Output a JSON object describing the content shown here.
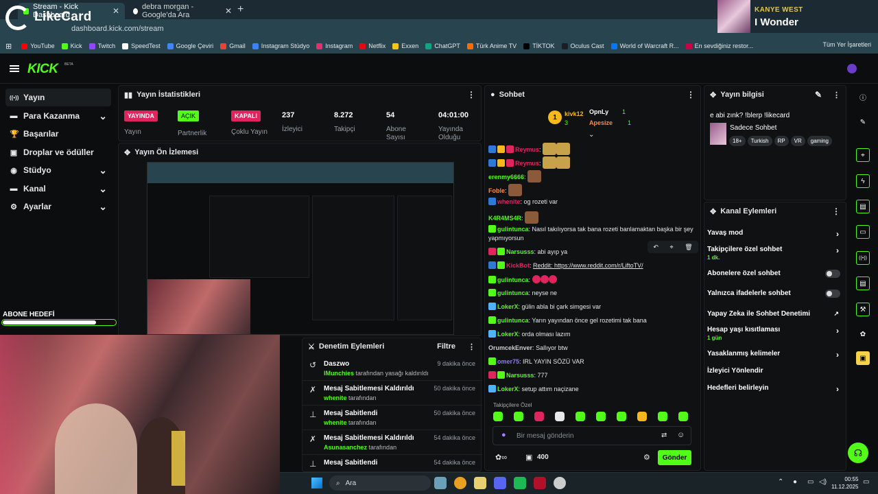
{
  "browser": {
    "tabs": [
      {
        "label": "Stream - Kick Dashboard"
      },
      {
        "label": "debra morgan - Google'da Ara"
      }
    ],
    "url": "dashboard.kick.com/stream",
    "bookmarks": [
      "YouTube",
      "Kick",
      "Twitch",
      "SpeedTest",
      "Google Çeviri",
      "Gmail",
      "Instagram Stüdyo",
      "Instagram",
      "Netflix",
      "Exxen",
      "ChatGPT",
      "Türk Anime TV",
      "TİKTOK",
      "Oculus Cast",
      "World of Warcraft R...",
      "En sevdiğiniz restor..."
    ],
    "all_bookmarks": "Tüm Yer İşaretleri"
  },
  "overlay": {
    "brand": "LikeCard",
    "music_artist": "KANYE WEST",
    "music_title": "I Wonder",
    "abone_hedefi": "ABONE HEDEFİ",
    "abone_progress": 0.83
  },
  "kick": {
    "logo": "KICK",
    "beta": "BETA"
  },
  "sidebar": {
    "items": [
      {
        "label": "Yayın",
        "icon": "broadcast-icon"
      },
      {
        "label": "Para Kazanma",
        "icon": "money-icon"
      },
      {
        "label": "Başarılar",
        "icon": "trophy-icon"
      },
      {
        "label": "Droplar ve ödüller",
        "icon": "gift-icon"
      },
      {
        "label": "Stüdyo",
        "icon": "studio-icon"
      },
      {
        "label": "Kanal",
        "icon": "channel-icon"
      },
      {
        "label": "Ayarlar",
        "icon": "gear-icon"
      }
    ]
  },
  "stats": {
    "title": "Yayın İstatistikleri",
    "yayinda": "YAYINDA",
    "yayin_label": "Yayın",
    "acik": "AÇIK",
    "partnerlik": "Partnerlik Geliri",
    "kapali": "KAPALI",
    "coklu": "Çoklu Yayın",
    "izleyici_val": "237",
    "izleyici": "İzleyici",
    "takipci_val": "8.272",
    "takipci": "Takipçi",
    "abone_val": "54",
    "abone": "Abone Sayısı",
    "sure_val": "04:01:00",
    "sure": "Yayında Olduğu"
  },
  "preview": {
    "title": "Yayın Ön İzlemesi"
  },
  "denetim": {
    "title": "Denetim Eylemleri",
    "filter": "Filtre",
    "items": [
      {
        "title": "Daszwo",
        "user": "lMunchies",
        "suffix": "tarafından yasağı kaldırıldı",
        "time": "9 dakika önce"
      },
      {
        "title": "Mesaj Sabitlemesi Kaldırıldı",
        "user": "whenite",
        "suffix": "tarafından",
        "time": "50 dakika önce"
      },
      {
        "title": "Mesaj Sabitlendi",
        "user": "whenite",
        "suffix": "tarafından",
        "time": "50 dakika önce"
      },
      {
        "title": "Mesaj Sabitlemesi Kaldırıldı",
        "user": "Asunasanchez",
        "suffix": "tarafından",
        "time": "54 dakika önce"
      },
      {
        "title": "Mesaj Sabitlendi",
        "user": "",
        "suffix": "",
        "time": "54 dakika önce"
      }
    ]
  },
  "chat": {
    "title": "Sohbet",
    "top": [
      {
        "rank": "1",
        "name": "kivk12",
        "count": "3"
      },
      {
        "rank": "",
        "name": "OpnLy",
        "count": "1"
      },
      {
        "rank": "",
        "name": "Apesize",
        "count": "1"
      }
    ],
    "messages": [
      {
        "user": "Reymus",
        "text": "",
        "color": "#e0245e"
      },
      {
        "user": "Reymus",
        "text": "",
        "color": "#e0245e"
      },
      {
        "user": "erenmy6666",
        "text": "",
        "color": "#53fc18"
      },
      {
        "user": "Foble",
        "text": "",
        "color": "#ff8a3d"
      },
      {
        "user": "whenite",
        "text": "og rozeti var",
        "color": "#e0245e"
      },
      {
        "user": "K4R4MS4R",
        "text": "",
        "color": "#53fc18"
      },
      {
        "user": "gulintunca",
        "text": "Nasıl takılıyorsa tak bana rozeti banlamaktan başka bir şey yapmıyorsun",
        "color": "#53fc18"
      },
      {
        "user": "Narsusss",
        "text": "abi ayıp ya",
        "color": "#53fc18"
      },
      {
        "user": "KickBot",
        "text": "Reddit: https://www.reddit.com/r/LiftoTV/",
        "color": "#e0245e"
      },
      {
        "user": "gulintunca",
        "text": "",
        "color": "#53fc18"
      },
      {
        "user": "gulintunca",
        "text": "neyse ne",
        "color": "#53fc18"
      },
      {
        "user": "LokerX",
        "text": "gülin abla bi çark simgesi var",
        "color": "#53fc18"
      },
      {
        "user": "gulintunca",
        "text": "Yarın yayından önce gel rozetimi tak bana",
        "color": "#53fc18"
      },
      {
        "user": "LokerX",
        "text": "orda olması lazım",
        "color": "#53fc18"
      },
      {
        "user": "OrumcekEnver",
        "text": "Sallıyor btw",
        "color": "#cfcfcf"
      },
      {
        "user": "omer75",
        "text": "IRL YAYIN SÖZÜ VAR",
        "color": "#8a7cff"
      },
      {
        "user": "Narsusss",
        "text": "777",
        "color": "#53fc18"
      },
      {
        "user": "LokerX",
        "text": "setup attım naçizane",
        "color": "#53fc18"
      }
    ],
    "followers_only": "Takipçilere Özel",
    "placeholder": "Bir mesaj gönderin",
    "points": "400",
    "send": "Gönder"
  },
  "info": {
    "title": "Yayın bilgisi",
    "stream_title": "e abi zınk? !blerp !likecard",
    "category": "Sadece Sohbet",
    "tags": [
      "18+",
      "Turkish",
      "RP",
      "VR",
      "gaming"
    ]
  },
  "kanal": {
    "title": "Kanal Eylemleri",
    "rows": [
      {
        "label": "Yavaş mod",
        "sub": "",
        "ctrl": "chevron"
      },
      {
        "label": "Takipçilere özel sohbet",
        "sub": "1 dk.",
        "ctrl": "chevron"
      },
      {
        "label": "Abonelere özel sohbet",
        "sub": "",
        "ctrl": "toggle"
      },
      {
        "label": "Yalnızca ifadelerle sohbet",
        "sub": "",
        "ctrl": "toggle"
      },
      {
        "label": "Yapay Zeka ile Sohbet Denetimi",
        "sub": "",
        "ctrl": "external"
      },
      {
        "label": "Hesap yaşı kısıtlaması",
        "sub": "1 gün",
        "ctrl": "chevron"
      },
      {
        "label": "Yasaklanmış kelimeler",
        "sub": "",
        "ctrl": "chevron"
      },
      {
        "label": "İzleyici Yönlendir",
        "sub": "",
        "ctrl": "none"
      },
      {
        "label": "Hedefleri belirleyin",
        "sub": "",
        "ctrl": "chevron"
      }
    ]
  },
  "taskbar": {
    "search": "Ara",
    "time": "00:55",
    "date": "11.12.2025"
  }
}
